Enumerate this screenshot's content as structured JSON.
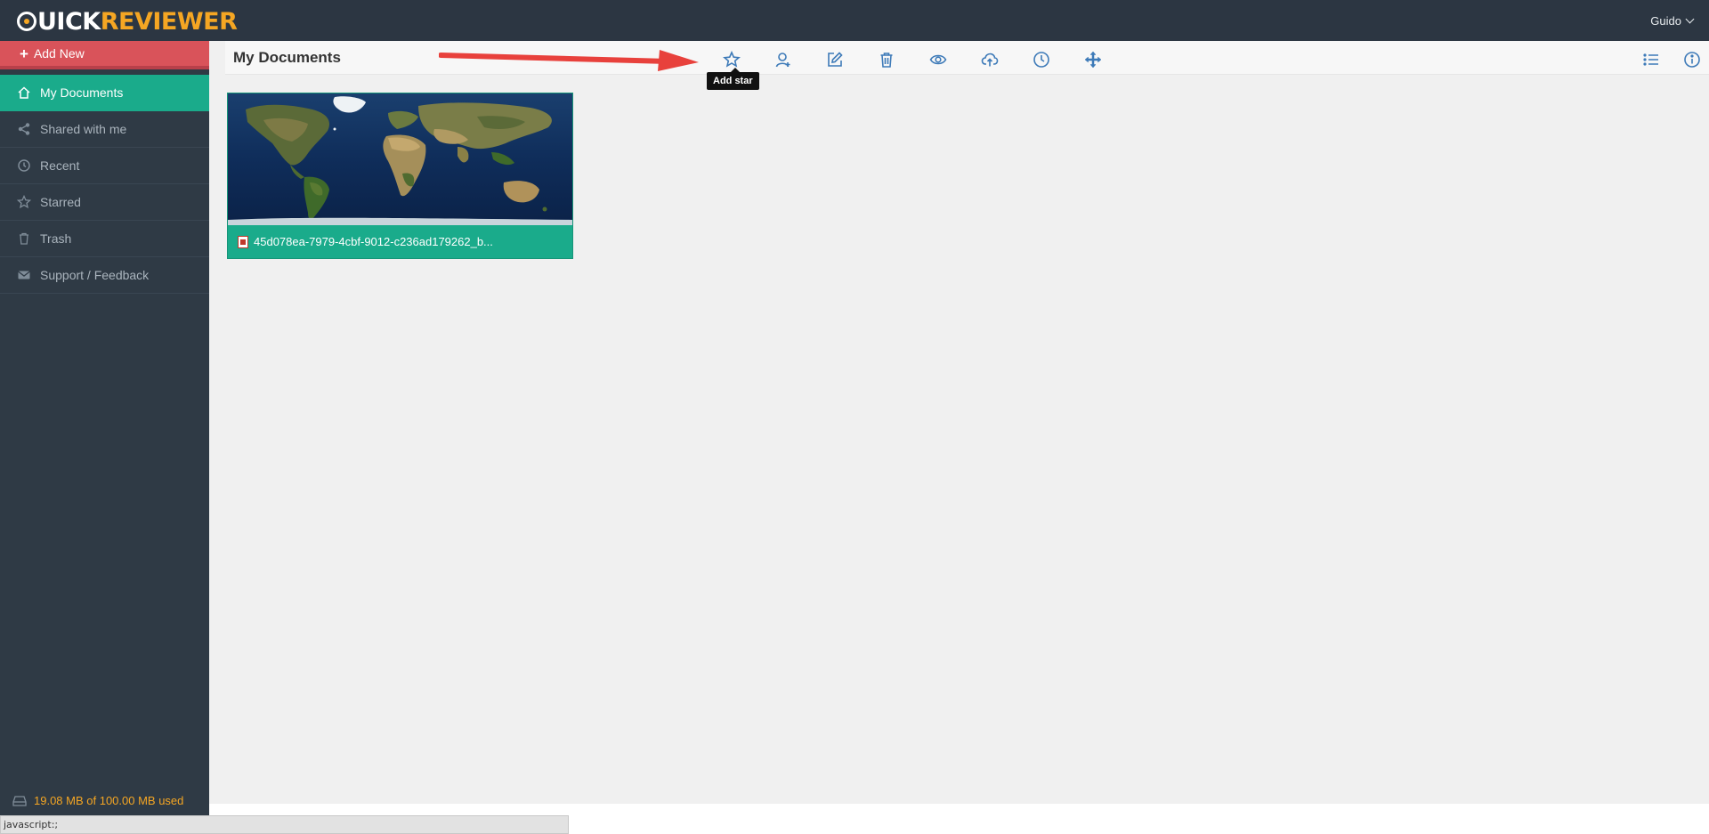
{
  "app": {
    "logo_left": "Q",
    "logo_rest": "UICK",
    "logo_right": "REVIEWER",
    "user_name": "Guido"
  },
  "sidebar": {
    "add_new_label": "Add New",
    "items": [
      {
        "label": "My Documents",
        "icon": "home-icon",
        "active": true
      },
      {
        "label": "Shared with me",
        "icon": "share-icon",
        "active": false
      },
      {
        "label": "Recent",
        "icon": "clock-icon",
        "active": false
      },
      {
        "label": "Starred",
        "icon": "star-icon",
        "active": false
      },
      {
        "label": "Trash",
        "icon": "trash-icon",
        "active": false
      },
      {
        "label": "Support / Feedback",
        "icon": "envelope-icon",
        "active": false
      }
    ],
    "storage_text": "19.08 MB of 100.00 MB used"
  },
  "toolbar": {
    "title": "My Documents",
    "tools": [
      "star-icon",
      "user-icon",
      "edit-icon",
      "trash-icon",
      "eye-icon",
      "cloud-upload-icon",
      "clock-icon",
      "move-icon"
    ],
    "tooltip": "Add star",
    "right_tools": [
      "list-view-icon",
      "info-icon"
    ]
  },
  "documents": [
    {
      "name": "45d078ea-7979-4cbf-9012-c236ad179262_b...",
      "type": "pdf"
    }
  ],
  "statusbar": {
    "text": "javascript:;"
  },
  "colors": {
    "accent": "#1aab8b",
    "add_new": "#d9535a",
    "storage": "#f5a623",
    "icon_blue": "#3d7ab8"
  }
}
